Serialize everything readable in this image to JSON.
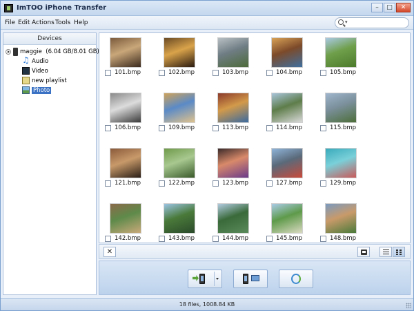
{
  "window": {
    "title": "ImTOO iPhone Transfer"
  },
  "menu": [
    {
      "label": "File"
    },
    {
      "label": "Edit"
    },
    {
      "label": "Actions"
    },
    {
      "label": "Tools"
    },
    {
      "label": "Help"
    }
  ],
  "search": {
    "placeholder": ""
  },
  "devices": {
    "header": "Devices",
    "device": {
      "name": "maggie",
      "capacity": "(6.04 GB/8.01 GB)"
    },
    "items": [
      {
        "label": "Audio",
        "icon": "music-icon"
      },
      {
        "label": "Video",
        "icon": "video-icon"
      },
      {
        "label": "new playlist",
        "icon": "playlist-icon"
      },
      {
        "label": "Photo",
        "icon": "photo-icon",
        "selected": true
      }
    ]
  },
  "photos": [
    {
      "name": "101.bmp",
      "colors": [
        "#7a5a3c",
        "#c9a77a",
        "#3b2a1e"
      ]
    },
    {
      "name": "102.bmp",
      "colors": [
        "#6a4a24",
        "#d9a34a",
        "#2a1a10"
      ]
    },
    {
      "name": "103.bmp",
      "colors": [
        "#b8c0c4",
        "#6f7d84",
        "#4d6a3a"
      ]
    },
    {
      "name": "104.bmp",
      "colors": [
        "#d9a256",
        "#7c4a2a",
        "#3f6f9f"
      ]
    },
    {
      "name": "105.bmp",
      "colors": [
        "#a9c9e3",
        "#6f9f4a",
        "#4c7a2c"
      ]
    },
    {
      "name": "106.bmp",
      "colors": [
        "#8a8a8a",
        "#dcdcdc",
        "#3a3a3a"
      ]
    },
    {
      "name": "109.bmp",
      "colors": [
        "#cfa35a",
        "#5a8ac7",
        "#e0c28c"
      ]
    },
    {
      "name": "113.bmp",
      "colors": [
        "#8b3a2a",
        "#d39a4a",
        "#3a6a9f"
      ]
    },
    {
      "name": "114.bmp",
      "colors": [
        "#a8c4da",
        "#5e7d4a",
        "#d9d9d9"
      ]
    },
    {
      "name": "115.bmp",
      "colors": [
        "#9fb6cd",
        "#7a8f9a",
        "#4d6e3a"
      ]
    },
    {
      "name": "121.bmp",
      "colors": [
        "#8a5a3a",
        "#c89a6a",
        "#2a1e16"
      ]
    },
    {
      "name": "122.bmp",
      "colors": [
        "#6f9a4a",
        "#a8c890",
        "#3a5a2a"
      ]
    },
    {
      "name": "123.bmp",
      "colors": [
        "#3a2a2a",
        "#d98a6a",
        "#6a3a8a"
      ]
    },
    {
      "name": "127.bmp",
      "colors": [
        "#8fb4d9",
        "#5a6a7a",
        "#c94a3a"
      ]
    },
    {
      "name": "129.bmp",
      "colors": [
        "#3aaabb",
        "#7ad0d9",
        "#c95a5a"
      ]
    },
    {
      "name": "142.bmp",
      "colors": [
        "#8a6a4a",
        "#5e8a4a",
        "#c9a97a"
      ]
    },
    {
      "name": "143.bmp",
      "colors": [
        "#9ac4e3",
        "#4a7a3a",
        "#2a4a2a"
      ]
    },
    {
      "name": "144.bmp",
      "colors": [
        "#b0cbe0",
        "#3a6a3a",
        "#5a8a5a"
      ]
    },
    {
      "name": "145.bmp",
      "colors": [
        "#a9cbe6",
        "#5e9a4a",
        "#d9d9c0"
      ]
    },
    {
      "name": "148.bmp",
      "colors": [
        "#7a9ac0",
        "#c99a6a",
        "#4a7a3a"
      ]
    }
  ],
  "toolbar": {
    "delete_label": "✕"
  },
  "status": {
    "text": "18 files, 1008.84 KB"
  }
}
